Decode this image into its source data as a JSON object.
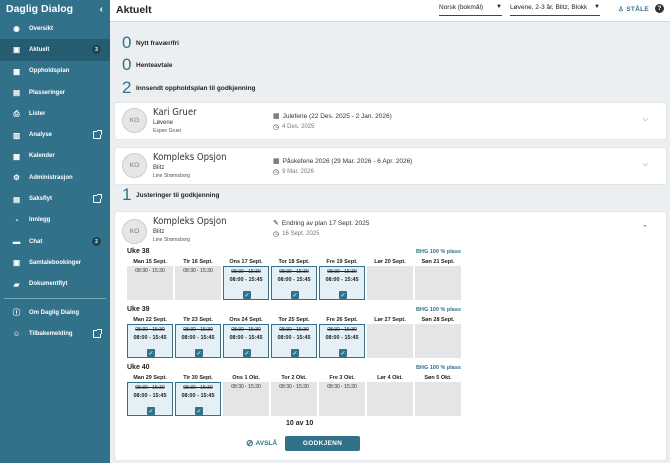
{
  "sidebar": {
    "title": "Daglig Dialog",
    "items": [
      {
        "label": "Oversikt",
        "icon": "eye-icon",
        "glyph": "◉"
      },
      {
        "label": "Aktuelt",
        "icon": "calendar-alert-icon",
        "glyph": "▣",
        "badge": "3",
        "active": true
      },
      {
        "label": "Oppholdsplan",
        "icon": "grid-calendar-icon",
        "glyph": "▦"
      },
      {
        "label": "Plasseringer",
        "icon": "contact-card-icon",
        "glyph": "▤"
      },
      {
        "label": "Lister",
        "icon": "printer-icon",
        "glyph": "⎙"
      },
      {
        "label": "Analyse",
        "icon": "bar-chart-icon",
        "glyph": "▥",
        "external": true
      },
      {
        "label": "Kalender",
        "icon": "calendar-icon",
        "glyph": "▦"
      },
      {
        "label": "Administrasjon",
        "icon": "gear-icon",
        "glyph": "⚙"
      },
      {
        "label": "Saksflyt",
        "icon": "document-icon",
        "glyph": "▤",
        "external": true
      },
      {
        "label": "Innlegg",
        "icon": "rss-icon",
        "glyph": "◔"
      },
      {
        "label": "Chat",
        "icon": "chat-icon",
        "glyph": "▬",
        "badge": "2"
      },
      {
        "label": "Samtalebookinger",
        "icon": "calendar-booking-icon",
        "glyph": "▣"
      },
      {
        "label": "Dokumentflyt",
        "icon": "folder-icon",
        "glyph": "▰"
      }
    ],
    "bottom_items": [
      {
        "label": "Om Daglig Dialog",
        "icon": "info-icon",
        "glyph": "ⓘ"
      },
      {
        "label": "Tilbakemelding",
        "icon": "feedback-icon",
        "glyph": "☺",
        "external": true
      }
    ]
  },
  "topbar": {
    "title": "Aktuelt",
    "language": "Norsk (bokmål)",
    "unit": "Løvene, 2-3 år, Blitz, Blokk",
    "user": "STÅLE",
    "help": "?"
  },
  "sections": [
    {
      "count": "0",
      "label": "Nytt fravær/fri"
    },
    {
      "count": "0",
      "label": "Henteavtale"
    },
    {
      "count": "2",
      "label": "Innsendt oppholdsplan til godkjenning"
    },
    {
      "count": "1",
      "label": "Justeringer til godkjenning"
    }
  ],
  "cards": [
    {
      "initials": "KG",
      "name": "Kari Gruer",
      "group": "Løvene",
      "sub": "Espen Gruer",
      "meta": "Juleferie (22 Des. 2025 - 2 Jan. 2026)",
      "date": "4 Des. 2025"
    },
    {
      "initials": "KO",
      "name": "Kompleks Opsjon",
      "group": "Blitz",
      "sub": "Line Strømsborg",
      "meta": "Påskeferie 2026 (29 Mar. 2026 - 6 Apr. 2026)",
      "date": "9 Mar. 2026"
    }
  ],
  "adjustment": {
    "initials": "KO",
    "name": "Kompleks Opsjon",
    "group": "Blitz",
    "sub": "Line Strømsborg",
    "meta": "Endring av plan 17 Sept. 2025",
    "date": "16 Sept. 2025",
    "weeks": [
      {
        "label": "Uke 38",
        "bhg": "BHG 100 % plass",
        "days": [
          {
            "name": "Man 15 Sept.",
            "kind": "normal",
            "text": "08:30 - 15:30"
          },
          {
            "name": "Tir 16 Sept.",
            "kind": "normal",
            "text": "08:30 - 15:30"
          },
          {
            "name": "Ons 17 Sept.",
            "kind": "changed",
            "old": "08:30 - 15:30",
            "new": "08:00 - 15:45"
          },
          {
            "name": "Tor 18 Sept.",
            "kind": "changed",
            "old": "08:30 - 15:30",
            "new": "08:00 - 15:45"
          },
          {
            "name": "Fre 19 Sept.",
            "kind": "changed",
            "old": "08:30 - 15:30",
            "new": "08:00 - 15:45"
          },
          {
            "name": "Lør 20 Sept.",
            "kind": "empty"
          },
          {
            "name": "Søn 21 Sept.",
            "kind": "empty"
          }
        ]
      },
      {
        "label": "Uke 39",
        "bhg": "BHG 100 % plass",
        "days": [
          {
            "name": "Man 22 Sept.",
            "kind": "changed",
            "old": "08:30 - 15:30",
            "new": "08:00 - 15:45"
          },
          {
            "name": "Tir 23 Sept.",
            "kind": "changed",
            "old": "08:30 - 15:30",
            "new": "08:00 - 15:45"
          },
          {
            "name": "Ons 24 Sept.",
            "kind": "changed",
            "old": "08:30 - 15:30",
            "new": "08:00 - 15:45"
          },
          {
            "name": "Tor 25 Sept.",
            "kind": "changed",
            "old": "08:30 - 15:30",
            "new": "08:00 - 15:45"
          },
          {
            "name": "Fre 26 Sept.",
            "kind": "changed",
            "old": "08:30 - 15:30",
            "new": "08:00 - 15:45"
          },
          {
            "name": "Lør 27 Sept.",
            "kind": "empty"
          },
          {
            "name": "Søn 28 Sept.",
            "kind": "empty"
          }
        ]
      },
      {
        "label": "Uke 40",
        "bhg": "BHG 100 % plass",
        "days": [
          {
            "name": "Man 29 Sept.",
            "kind": "changed",
            "old": "08:30 - 15:30",
            "new": "08:00 - 15:45"
          },
          {
            "name": "Tir 30 Sept.",
            "kind": "changed",
            "old": "08:30 - 15:30",
            "new": "08:00 - 15:45"
          },
          {
            "name": "Ons 1 Okt.",
            "kind": "normal",
            "text": "08:30 - 15:30"
          },
          {
            "name": "Tor 2 Okt.",
            "kind": "normal",
            "text": "08:30 - 15:30"
          },
          {
            "name": "Fre 3 Okt.",
            "kind": "normal",
            "text": "08:30 - 15:30"
          },
          {
            "name": "Lør 4 Okt.",
            "kind": "empty"
          },
          {
            "name": "Søn 5 Okt.",
            "kind": "empty"
          }
        ]
      }
    ],
    "count": "10 av 10",
    "reject_label": "AVSLÅ",
    "approve_label": "GODKJENN"
  },
  "colors": {
    "accent": "#31718a",
    "sidebar": "#31718a"
  }
}
